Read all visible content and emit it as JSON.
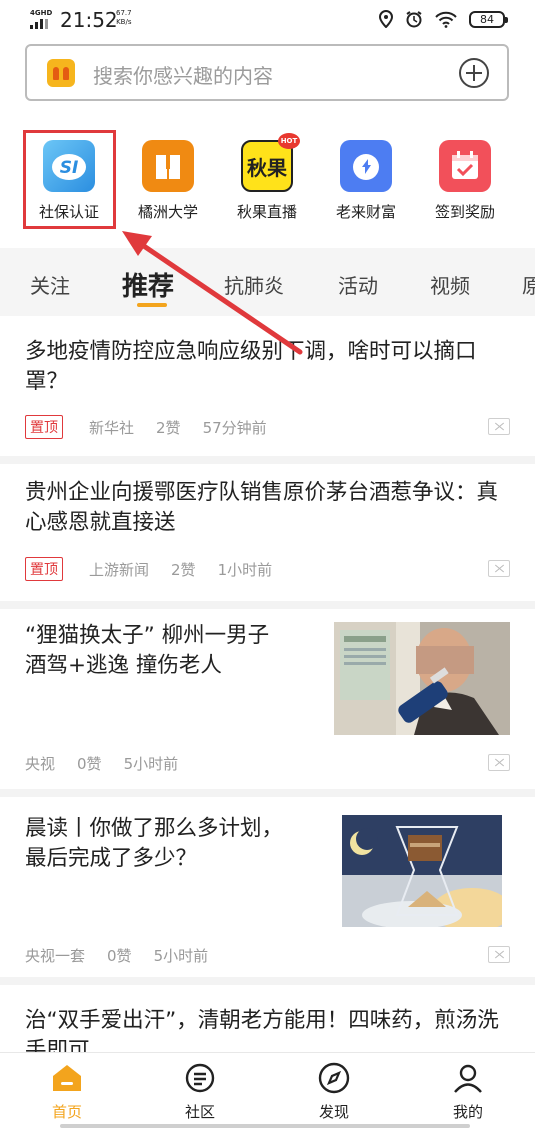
{
  "status_bar": {
    "network": "4GHD",
    "time": "21:52",
    "speed_value": "67.7",
    "speed_unit": "KB/s",
    "battery": "84",
    "icons": [
      "location-icon",
      "alarm-icon",
      "wifi-icon",
      "battery-icon"
    ]
  },
  "search": {
    "placeholder": "搜索你感兴趣的内容",
    "logo_icon": "app-logo-icon",
    "add_icon": "plus-circle-icon"
  },
  "shortcuts": [
    {
      "label": "社保认证",
      "icon": "social-security-icon",
      "color": "#2b8ee0"
    },
    {
      "label": "橘洲大学",
      "icon": "book-icon",
      "color": "#f08a12"
    },
    {
      "label": "秋果直播",
      "icon": "live-icon",
      "color": "#ffe21a",
      "badge": "HOT"
    },
    {
      "label": "老来财富",
      "icon": "wealth-icon",
      "color": "#4d7df2"
    },
    {
      "label": "签到奖励",
      "icon": "calendar-check-icon",
      "color": "#f2505a"
    }
  ],
  "tabs": [
    "关注",
    "推荐",
    "抗肺炎",
    "活动",
    "视频",
    "原"
  ],
  "active_tab": "推荐",
  "feed": [
    {
      "title": "多地疫情防控应急响应级别下调，啥时可以摘口罩？",
      "tag": "置顶",
      "source": "新华社",
      "likes": "2赞",
      "time": "57分钟前"
    },
    {
      "title": "贵州企业向援鄂医疗队销售原价茅台酒惹争议：真心感恩就直接送",
      "tag": "置顶",
      "source": "上游新闻",
      "likes": "2赞",
      "time": "1小时前"
    },
    {
      "title": "“狸猫换太子” 柳州一男子酒驾+逃逸 撞伤老人",
      "source": "央视",
      "likes": "0赞",
      "time": "5小时前",
      "thumbnail": "breathalyzer-photo"
    },
    {
      "title": "晨读丨你做了那么多计划，最后完成了多少？",
      "source": "央视一套",
      "likes": "0赞",
      "time": "5小时前",
      "thumbnail": "hourglass-photo"
    },
    {
      "title": "治“双手爱出汗”，清朝老方能用！四味药，煎汤洗手即可"
    }
  ],
  "bottom_nav": [
    {
      "label": "首页",
      "icon": "home-icon",
      "active": true
    },
    {
      "label": "社区",
      "icon": "community-icon"
    },
    {
      "label": "发现",
      "icon": "compass-icon"
    },
    {
      "label": "我的",
      "icon": "profile-icon"
    }
  ],
  "colors": {
    "accent": "#f3a41d",
    "annotation_red": "#e0393c",
    "tag_red": "#e0393c",
    "meta_gray": "#9a9a9a"
  }
}
